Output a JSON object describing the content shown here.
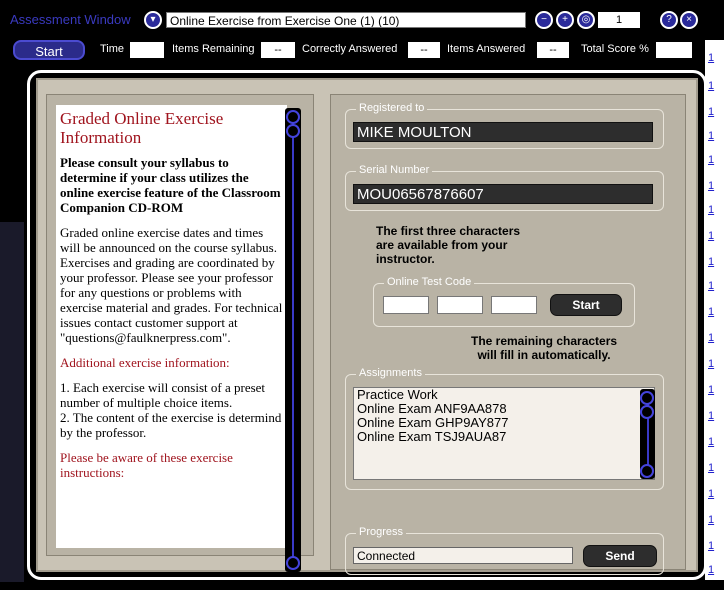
{
  "window": {
    "title": "Assessment Window",
    "exercise_title": "Online Exercise from Exercise One (1) (10)",
    "page_number": "1"
  },
  "statusbar": {
    "start_label": "Start",
    "time_label": "Time",
    "time_value": "",
    "items_remaining_label": "Items Remaining",
    "items_remaining_value": "--",
    "correctly_answered_label": "Correctly Answered",
    "correctly_answered_value": "--",
    "items_answered_label": "Items Answered",
    "items_answered_value": "--",
    "total_score_label": "Total Score %",
    "total_score_value": ""
  },
  "info": {
    "title": "Graded Online Exercise Information",
    "intro_bold": "Please consult your syllabus to determine if your class utilizes the online exercise feature of the Classroom Companion CD-ROM",
    "paragraph": "Graded online exercise dates and times will be announced on the course syllabus. Exercises and grading are coordinated by your professor. Please see your professor for any questions or problems with exercise material and grades. For technical issues contact customer support at \"questions@faulknerpress.com\".",
    "additional_heading": "Additional exercise information:",
    "item1": "1. Each exercise will consist of a preset number of multiple choice items.",
    "item2": "2. The content of the exercise is determind by the professor.",
    "warning": "Please be aware of these exercise instructions:"
  },
  "registration": {
    "registered_legend": "Registered to",
    "registered_value": "MIKE MOULTON",
    "serial_legend": "Serial Number",
    "serial_value": "MOU06567876607",
    "note_top": "The first three characters are available from your instructor.",
    "note_top_lines": [
      "The first three characters",
      "are available from your",
      "instructor."
    ],
    "code_legend": "Online Test Code",
    "code_start_label": "Start",
    "note_bottom_lines": [
      "The remaining characters",
      "will fill in automatically."
    ]
  },
  "assignments": {
    "legend": "Assignments",
    "items": [
      "Practice Work",
      "Online Exam ANF9AA878",
      "Online Exam GHP9AY877",
      "Online Exam TSJ9AUA87"
    ]
  },
  "progress": {
    "legend": "Progress",
    "status": "Connected",
    "send_label": "Send"
  },
  "icons": {
    "dropdown": "chevron-down-icon",
    "minus": "minus-icon",
    "plus": "plus-icon",
    "target": "target-icon",
    "help": "help-icon",
    "close": "close-icon"
  },
  "colors": {
    "accent": "#2b2b8a",
    "title_red": "#a0141e",
    "panel": "#c9c3b5",
    "dark_field": "#2d2d2d"
  }
}
